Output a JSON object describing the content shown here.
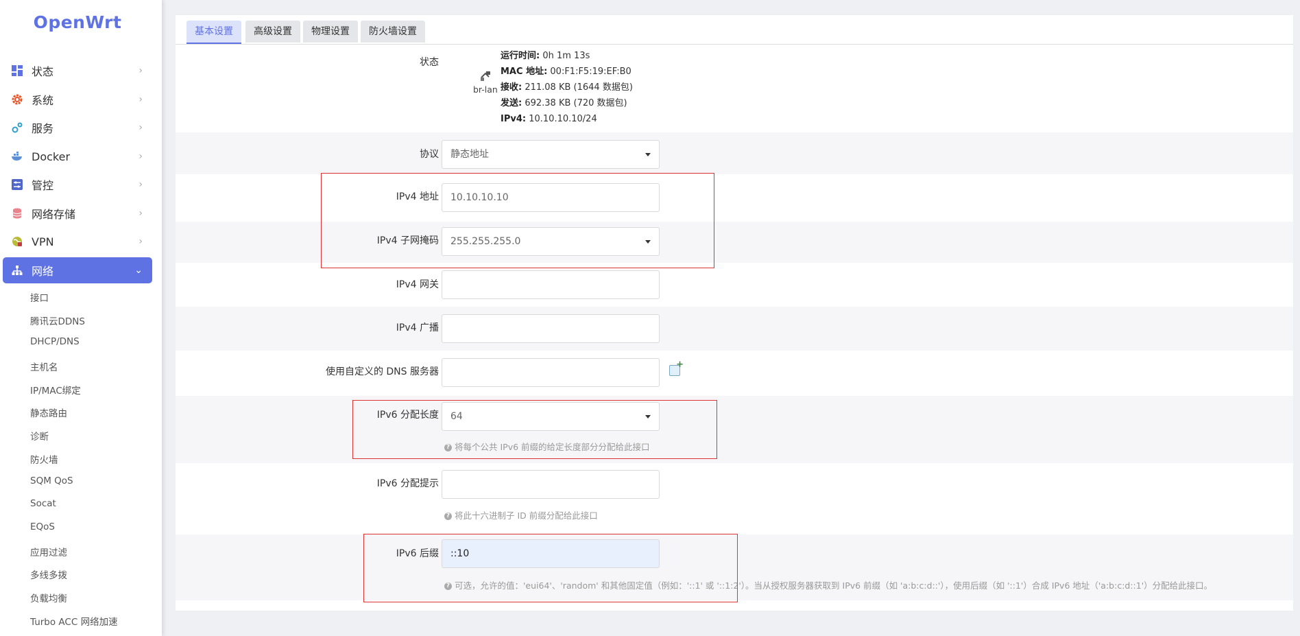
{
  "sidebar": {
    "logo": "OpenWrt",
    "items": [
      {
        "label": "状态",
        "icon": "dashboard-icon"
      },
      {
        "label": "系统",
        "icon": "gear-icon"
      },
      {
        "label": "服务",
        "icon": "cogs-icon"
      },
      {
        "label": "Docker",
        "icon": "docker-icon"
      },
      {
        "label": "管控",
        "icon": "sliders-icon"
      },
      {
        "label": "网络存储",
        "icon": "database-icon"
      },
      {
        "label": "VPN",
        "icon": "globe-lock-icon"
      },
      {
        "label": "网络",
        "icon": "network-icon"
      }
    ],
    "submenu": [
      "接口",
      "腾讯云DDNS",
      "DHCP/DNS",
      "主机名",
      "IP/MAC绑定",
      "静态路由",
      "诊断",
      "防火墙",
      "SQM QoS",
      "Socat",
      "EQoS",
      "应用过滤",
      "多线多拨",
      "负载均衡",
      "Turbo ACC 网络加速"
    ]
  },
  "tabs": [
    "基本设置",
    "高级设置",
    "物理设置",
    "防火墙设置"
  ],
  "status": {
    "label": "状态",
    "iface": "br-lan",
    "uptime_key": "运行时间:",
    "uptime": "0h 1m 13s",
    "mac_key": "MAC 地址:",
    "mac": "00:F1:F5:19:EF:B0",
    "rx_key": "接收:",
    "rx": "211.08 KB (1644 数据包)",
    "tx_key": "发送:",
    "tx": "692.38 KB (720 数据包)",
    "ipv4_key": "IPv4:",
    "ipv4": "10.10.10.10/24"
  },
  "form": {
    "protocol": {
      "label": "协议",
      "value": "静态地址"
    },
    "ipv4_addr": {
      "label": "IPv4 地址",
      "value": "10.10.10.10"
    },
    "ipv4_mask": {
      "label": "IPv4 子网掩码",
      "value": "255.255.255.0"
    },
    "ipv4_gw": {
      "label": "IPv4 网关",
      "value": ""
    },
    "ipv4_bcast": {
      "label": "IPv4 广播",
      "value": ""
    },
    "dns": {
      "label": "使用自定义的 DNS 服务器",
      "value": ""
    },
    "ip6assign": {
      "label": "IPv6 分配长度",
      "value": "64",
      "hint": "将每个公共 IPv6 前缀的给定长度部分分配给此接口"
    },
    "ip6hint": {
      "label": "IPv6 分配提示",
      "value": "",
      "hint": "将此十六进制子 ID 前缀分配给此接口"
    },
    "ip6ifaceid": {
      "label": "IPv6 后缀",
      "value": "::10",
      "hint": "可选，允许的值：'eui64'、'random' 和其他固定值（例如：'::1' 或 '::1:2'）。当从授权服务器获取到 IPv6 前缀（如 'a:b:c:d::'），使用后缀（如 '::1'）合成 IPv6 地址（'a:b:c:d::1'）分配给此接口。"
    }
  },
  "colors": {
    "accent": "#5e72e4",
    "highlight": "#d33"
  }
}
